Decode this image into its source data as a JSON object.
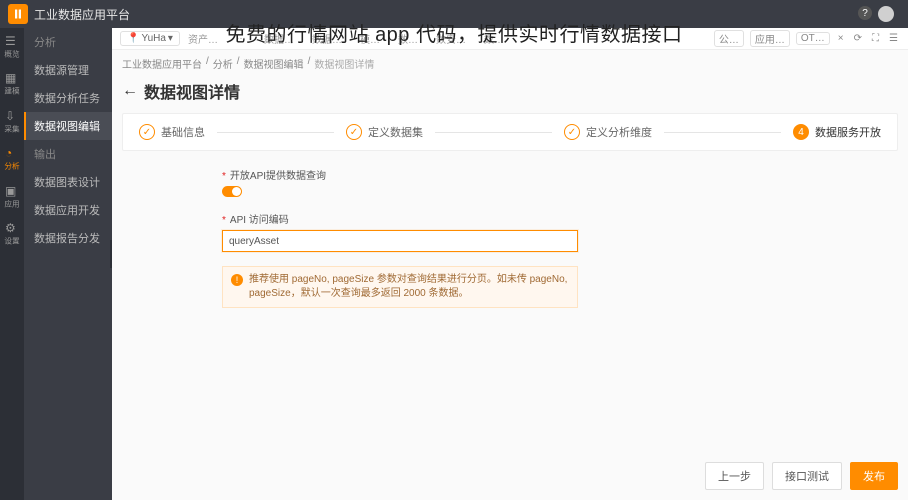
{
  "header": {
    "app_title": "工业数据应用平台"
  },
  "overlay_text": "免费的行情网站 app 代码，提供实时行情数据接口",
  "header_right": {
    "help": "?"
  },
  "topstrip": {
    "location_prefix": "YuHa",
    "right": {
      "utils": "公…",
      "apps": "应用…",
      "ot": "OT…"
    },
    "menus": [
      "资产…",
      "…",
      "…",
      "数据…",
      "数据…",
      "…",
      "模…",
      "数…",
      "数安…",
      "数…",
      "数…"
    ]
  },
  "rail": [
    {
      "label": "概览"
    },
    {
      "label": "建模"
    },
    {
      "label": "采集"
    },
    {
      "label": "分析"
    },
    {
      "label": "应用"
    },
    {
      "label": "设置"
    }
  ],
  "side": {
    "heading1": "分析",
    "items1": [
      "数据源管理",
      "数据分析任务",
      "数据视图编辑"
    ],
    "heading2": "输出",
    "items2": [
      "数据图表设计",
      "数据应用开发",
      "数据报告分发"
    ]
  },
  "breadcrumb": [
    "工业数据应用平台",
    "分析",
    "数据视图编辑",
    "数据视图详情"
  ],
  "page_title": "数据视图详情",
  "steps": [
    {
      "label": "基础信息",
      "mark": "✓"
    },
    {
      "label": "定义数据集",
      "mark": "✓"
    },
    {
      "label": "定义分析维度",
      "mark": "✓"
    },
    {
      "label": "数据服务开放",
      "mark": "4"
    }
  ],
  "form": {
    "api_toggle_label": "开放API提供数据查询",
    "api_code_label": "API 访问编码",
    "api_code_value": "queryAsset",
    "hint_text": "推荐使用 pageNo, pageSize 参数对查询结果进行分页。如未传 pageNo, pageSize，默认一次查询最多返回 2000 条数据。"
  },
  "footer": {
    "prev": "上一步",
    "test": "接口测试",
    "save": "发布"
  }
}
